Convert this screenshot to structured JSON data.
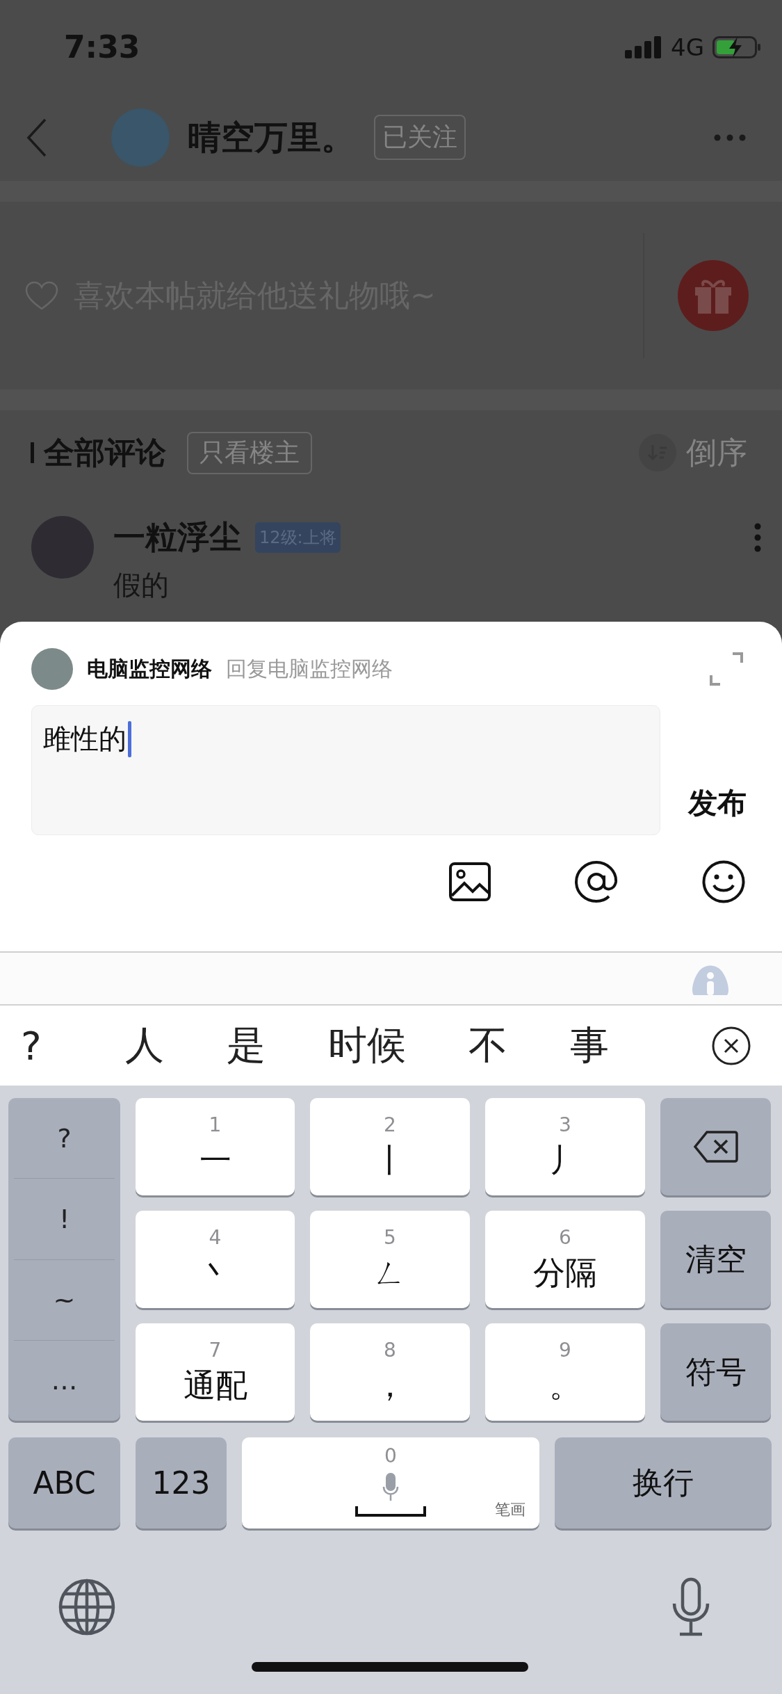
{
  "status_bar": {
    "time": "7:33",
    "network": "4G",
    "charging": true
  },
  "post_header": {
    "author": "晴空万里。",
    "follow_button": "已关注"
  },
  "gift_bar": {
    "prompt": "喜欢本帖就给他送礼物哦~"
  },
  "comments_header": {
    "title": "全部评论",
    "filter_button": "只看楼主",
    "sort_button": "倒序"
  },
  "comments": [
    {
      "author": "一粒浮尘",
      "badge": "12级:上将",
      "text": "假的"
    }
  ],
  "reply_sheet": {
    "user": "电脑监控网络",
    "reply_to": "回复电脑监控网络",
    "value": "雎性的",
    "submit": "发布"
  },
  "keyboard": {
    "candidates": [
      "?",
      "人",
      "是",
      "时候",
      "不",
      "事"
    ],
    "side_symbols": [
      "?",
      "!",
      "~",
      "…"
    ],
    "keys": [
      {
        "number": "1",
        "label": "一"
      },
      {
        "number": "2",
        "label": "丨"
      },
      {
        "number": "3",
        "label": "丿"
      },
      {
        "number": "4",
        "label": "丶"
      },
      {
        "number": "5",
        "label": "ㄥ"
      },
      {
        "number": "6",
        "label": "分隔"
      },
      {
        "number": "7",
        "label": "通配"
      },
      {
        "number": "8",
        "label": "，"
      },
      {
        "number": "9",
        "label": "。"
      }
    ],
    "function_keys": [
      {
        "kind": "delete"
      },
      {
        "kind": "text",
        "label": "清空"
      },
      {
        "kind": "text",
        "label": "符号"
      }
    ],
    "abc_key": "ABC",
    "number_key": "123",
    "space_number": "0",
    "space_hint": "笔画",
    "return_key": "换行"
  }
}
